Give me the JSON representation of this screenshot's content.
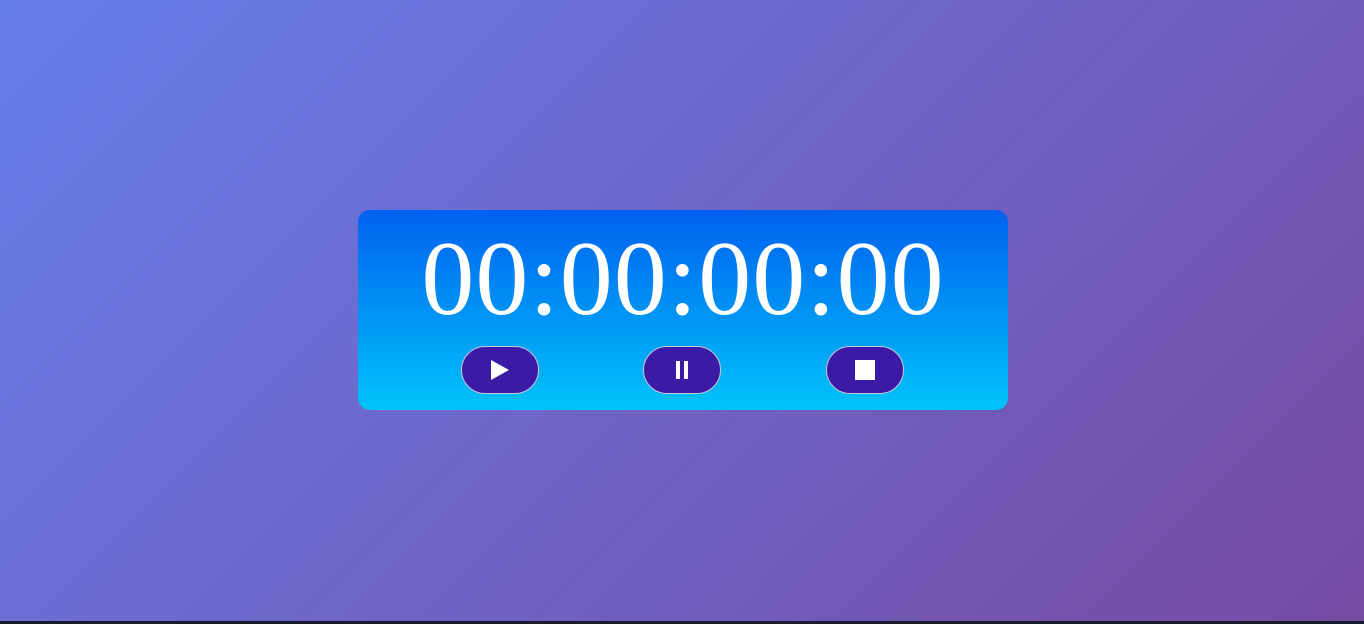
{
  "stopwatch": {
    "time_display": "00:00:00:00",
    "panel_gradient_top": "#0060ee",
    "panel_gradient_bottom": "#00c3fa",
    "button_color": "#3b1aa6"
  },
  "controls": {
    "start_icon": "play-icon",
    "pause_icon": "pause-icon",
    "stop_icon": "stop-icon"
  },
  "background": {
    "gradient_start": "#667eea",
    "gradient_end": "#764ba2"
  }
}
